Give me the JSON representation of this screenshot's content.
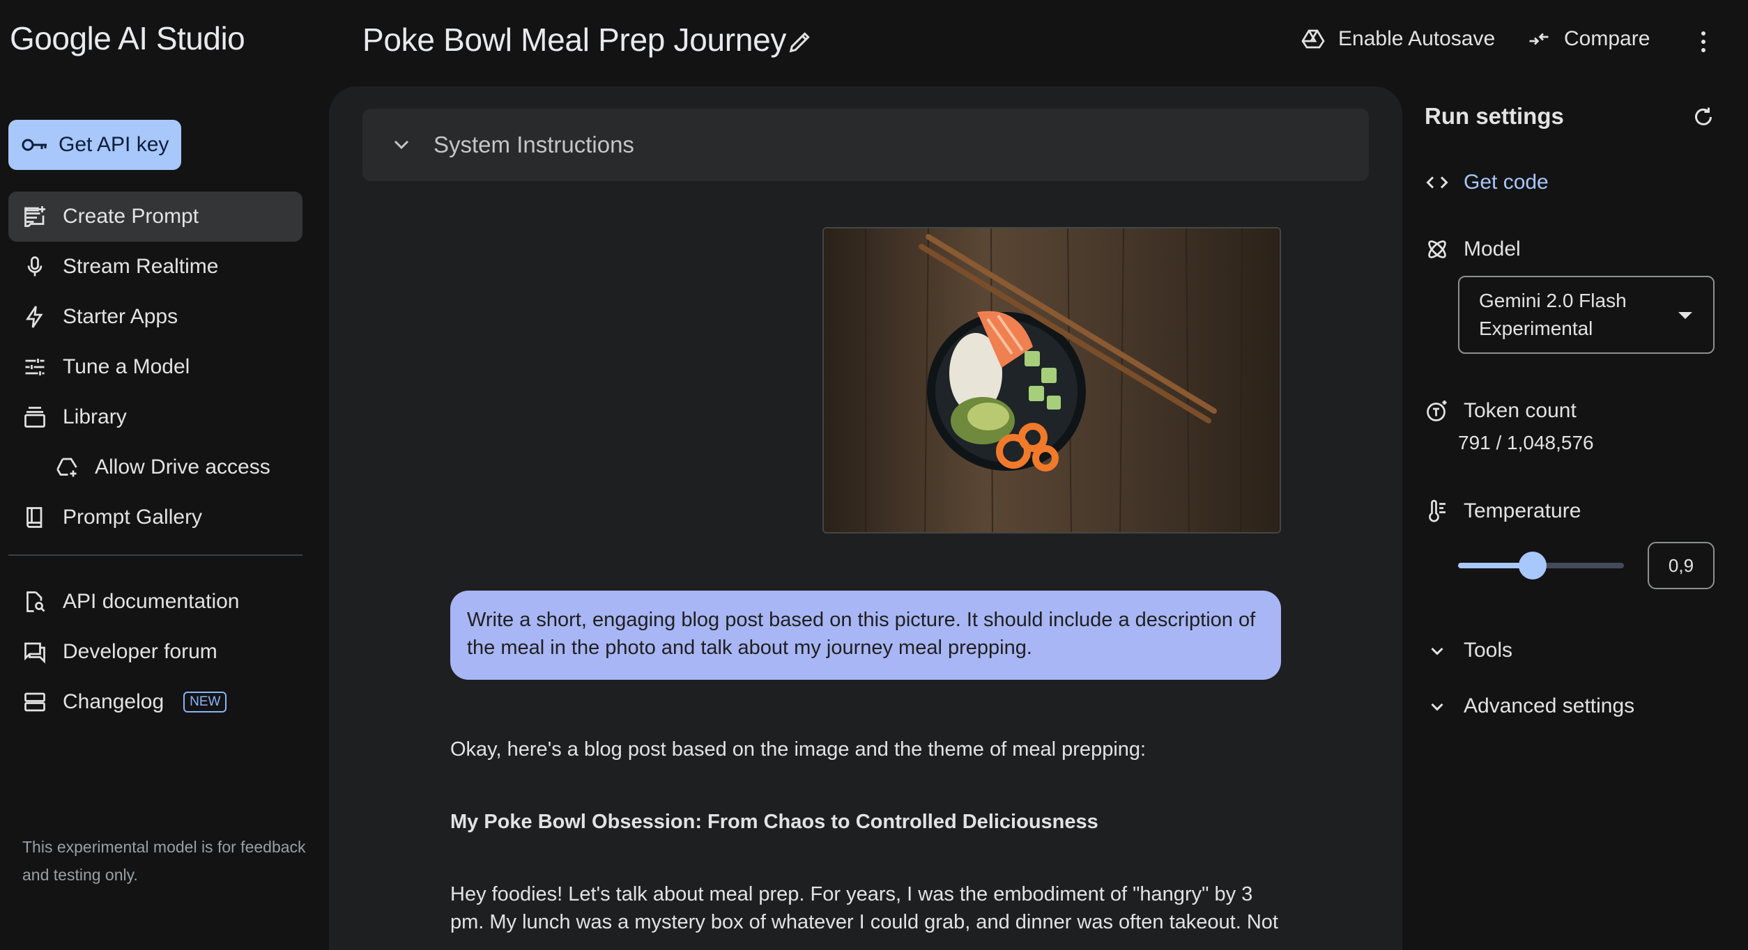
{
  "app": {
    "name": "Google AI Studio"
  },
  "header": {
    "title": "Poke Bowl Meal Prep Journey",
    "autosave_label": "Enable Autosave",
    "compare_label": "Compare"
  },
  "sidebar": {
    "api_key_label": "Get API key",
    "items": [
      {
        "label": "Create Prompt",
        "icon": "create-prompt-icon",
        "active": true
      },
      {
        "label": "Stream Realtime",
        "icon": "mic-icon"
      },
      {
        "label": "Starter Apps",
        "icon": "bolt-icon"
      },
      {
        "label": "Tune a Model",
        "icon": "tune-icon"
      },
      {
        "label": "Library",
        "icon": "library-icon"
      },
      {
        "label": "Allow Drive access",
        "icon": "drive-icon"
      },
      {
        "label": "Prompt Gallery",
        "icon": "book-icon"
      }
    ],
    "links": [
      {
        "label": "API documentation",
        "icon": "doc-search-icon"
      },
      {
        "label": "Developer forum",
        "icon": "forum-icon"
      },
      {
        "label": "Changelog",
        "icon": "changelog-icon",
        "badge": "NEW"
      }
    ],
    "footer_note": "This experimental model is for feedback and testing only."
  },
  "main": {
    "system_instructions_label": "System Instructions",
    "user_message": "Write a short, engaging blog post based on this picture. It should include a description of the meal in the photo and talk about my journey meal prepping.",
    "response": {
      "intro": "Okay, here's a blog post based on the image and the theme of meal prepping:",
      "title": "My Poke Bowl Obsession: From Chaos to Controlled Deliciousness",
      "paragraph": "Hey foodies! Let's talk about meal prep. For years, I was the embodiment of \"hangry\" by 3 pm. My lunch was a mystery box of whatever I could grab, and dinner was often takeout. Not"
    }
  },
  "run_settings": {
    "title": "Run settings",
    "get_code_label": "Get code",
    "model_label": "Model",
    "model_value": "Gemini 2.0 Flash Experimental",
    "token_label": "Token count",
    "token_value": "791 / 1,048,576",
    "temperature_label": "Temperature",
    "temperature_value": "0,9",
    "temperature_fraction": 0.45,
    "tools_label": "Tools",
    "advanced_label": "Advanced settings"
  },
  "colors": {
    "background": "#131314",
    "panel": "#1e1f20",
    "accent": "#a8c7fa",
    "user_bubble": "#a8b6f5"
  }
}
